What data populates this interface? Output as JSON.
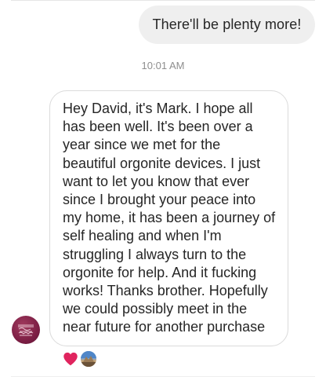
{
  "sent_message": {
    "text": "There'll be plenty more!"
  },
  "timestamp": "10:01 AM",
  "received_message": {
    "text": "Hey David, it's Mark. I hope all has been well. It's been over a year since we met for the beautiful orgonite devices. I just want to let you know that ever since I brought your peace into my home, it has been a journey of self healing and when I'm struggling I always turn to the orgonite for help. And it fucking works! Thanks brother. Hopefully we could possibly meet in the near future for another purchase"
  },
  "sender_avatar": {
    "icon": "logo-avatar",
    "color": "#7d1f45"
  },
  "reactions": {
    "emoji_icon": "heart-icon",
    "emoji_color": "#e0245e",
    "reactor_icon": "reactor-avatar"
  }
}
